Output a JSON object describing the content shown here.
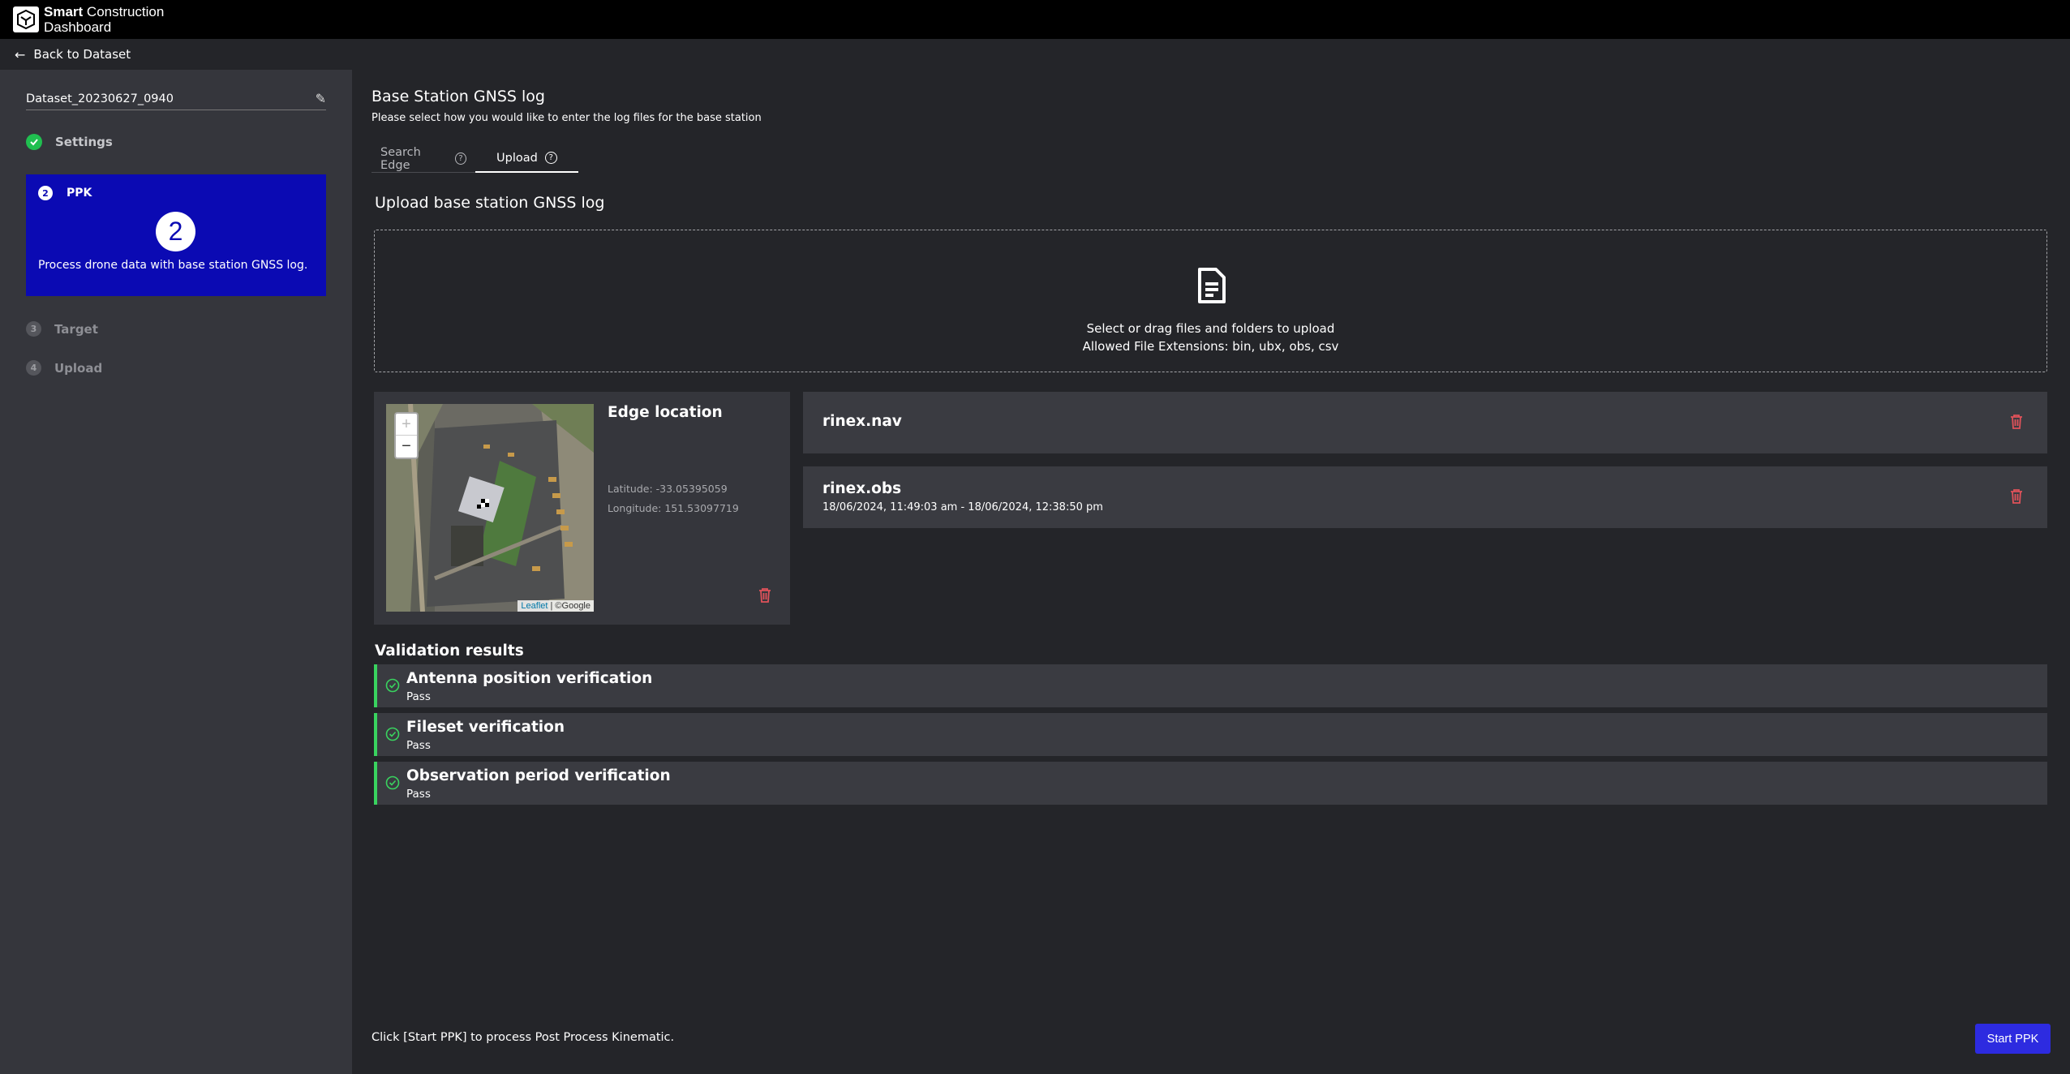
{
  "header": {
    "brand_bold": "Smart",
    "brand_rest": " Construction",
    "brand_line2": "Dashboard",
    "back_label": "Back to Dataset"
  },
  "sidebar": {
    "dataset_name": "Dataset_20230627_0940",
    "steps": [
      {
        "num": "1",
        "label": "Settings",
        "status": "complete"
      },
      {
        "num": "2",
        "label": "PPK",
        "status": "active",
        "description": "Process drone data with base station GNSS log."
      },
      {
        "num": "3",
        "label": "Target",
        "status": "pending"
      },
      {
        "num": "4",
        "label": "Upload",
        "status": "pending"
      }
    ]
  },
  "main": {
    "title": "Base Station GNSS log",
    "subtitle": "Please select how you would like to enter the log files for the base station",
    "tabs": [
      {
        "label": "Search Edge",
        "help": "?"
      },
      {
        "label": "Upload",
        "help": "?"
      }
    ],
    "upload_title": "Upload base station GNSS log",
    "dropzone_line1": "Select or drag files and folders to upload",
    "dropzone_line2": "Allowed File Extensions: bin, ubx, obs, csv"
  },
  "edge": {
    "title": "Edge location",
    "latitude": "Latitude: -33.05395059",
    "longitude": "Longitude: 151.53097719",
    "map_attrib_leaflet": "Leaflet",
    "map_attrib_sep": " | ",
    "map_attrib_google": "©Google",
    "zoom_in": "+",
    "zoom_out": "−"
  },
  "files": [
    {
      "name": "rinex.nav",
      "date": ""
    },
    {
      "name": "rinex.obs",
      "date": "18/06/2024, 11:49:03 am - 18/06/2024, 12:38:50 pm"
    }
  ],
  "validation": {
    "title": "Validation results",
    "items": [
      {
        "name": "Antenna position verification",
        "status": "Pass"
      },
      {
        "name": "Fileset verification",
        "status": "Pass"
      },
      {
        "name": "Observation period verification",
        "status": "Pass"
      }
    ]
  },
  "footer": {
    "hint": "Click [Start PPK] to process Post Process Kinematic.",
    "start_button": "Start PPK"
  },
  "colors": {
    "active_step": "#0b0ab3",
    "success": "#39d35f",
    "primary_button": "#2d2be0",
    "delete_icon": "#e0525a"
  }
}
